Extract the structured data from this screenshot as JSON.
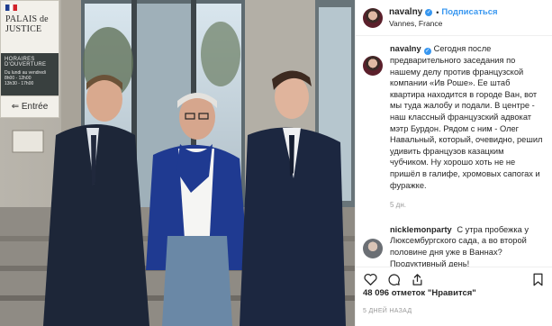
{
  "post": {
    "username": "navalny",
    "follow_label": "Подписаться",
    "separator": "•",
    "location": "Vannes, France"
  },
  "photo": {
    "sign_title_1": "PALAIS de",
    "sign_title_2": "JUSTICE",
    "sign_hours_title": "HORAIRES D'OUVERTURE",
    "sign_hours_line1": "Du lundi au vendredi",
    "sign_hours_line2": "8h00 - 12h00",
    "sign_hours_line3": "13h30 - 17h00",
    "sign_entree": "⇐ Entrée"
  },
  "caption": {
    "username": "navalny",
    "text": "Сегодня после предварительного заседания по нашему делу против французской компании «Ив Роше». Ее штаб квартира находится в городе Ван, вот мы туда жалобу и подали. В центре - наш классный французский адвокат мэтр Бурдон. Рядом с ним - Олег Навальный, который, очевидно, решил удивить французов казацким чубчиком. Ну хорошо хоть не не пришёл в галифе, хромовых сапогах и фуражке.",
    "time": "5 дн."
  },
  "comment": {
    "username": "nicklemonparty",
    "text": "С утра пробежка у Люксембургского сада, а во второй половине дня уже в Ваннах? Продуктивный день!"
  },
  "actions": {
    "likes": "48 096 отметок \"Нравится\"",
    "age": "5 ДНЕЙ НАЗАД"
  },
  "colors": {
    "link_blue": "#3897f0",
    "text": "#262626",
    "muted": "#999999",
    "border": "#efefef"
  },
  "icons": [
    "verified-badge-icon",
    "heart-icon",
    "comment-icon",
    "share-icon",
    "bookmark-icon"
  ]
}
